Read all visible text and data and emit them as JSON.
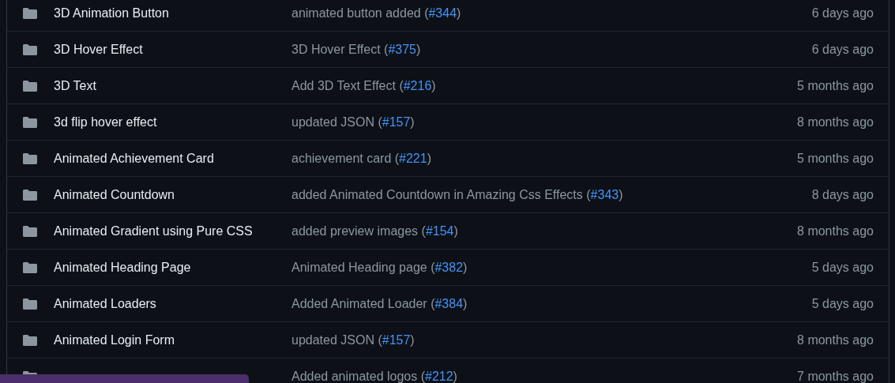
{
  "rows": [
    {
      "name": "3D Animation Button",
      "message": "animated button added (",
      "link": "#344",
      "suffix": ")",
      "time": "6 days ago"
    },
    {
      "name": "3D Hover Effect",
      "message": "3D Hover Effect (",
      "link": "#375",
      "suffix": ")",
      "time": "6 days ago"
    },
    {
      "name": "3D Text",
      "message": "Add 3D Text Effect (",
      "link": "#216",
      "suffix": ")",
      "time": "5 months ago"
    },
    {
      "name": "3d flip hover effect",
      "message": "updated JSON (",
      "link": "#157",
      "suffix": ")",
      "time": "8 months ago"
    },
    {
      "name": "Animated Achievement Card",
      "message": "achievement card (",
      "link": "#221",
      "suffix": ")",
      "time": "5 months ago"
    },
    {
      "name": "Animated Countdown",
      "message": "added Animated Countdown in Amazing Css Effects (",
      "link": "#343",
      "suffix": ")",
      "time": "8 days ago"
    },
    {
      "name": "Animated Gradient using Pure CSS",
      "message": "added preview images (",
      "link": "#154",
      "suffix": ")",
      "time": "8 months ago"
    },
    {
      "name": "Animated Heading Page",
      "message": "Animated Heading page (",
      "link": "#382",
      "suffix": ")",
      "time": "5 days ago"
    },
    {
      "name": "Animated Loaders",
      "message": "Added Animated Loader (",
      "link": "#384",
      "suffix": ")",
      "time": "5 days ago"
    },
    {
      "name": "Animated Login Form",
      "message": "updated JSON (",
      "link": "#157",
      "suffix": ")",
      "time": "8 months ago"
    },
    {
      "message": "Added animated logos (",
      "link": "#212",
      "suffix": ")",
      "time": "7 months ago"
    }
  ],
  "status_bar": {
    "shown": true
  }
}
